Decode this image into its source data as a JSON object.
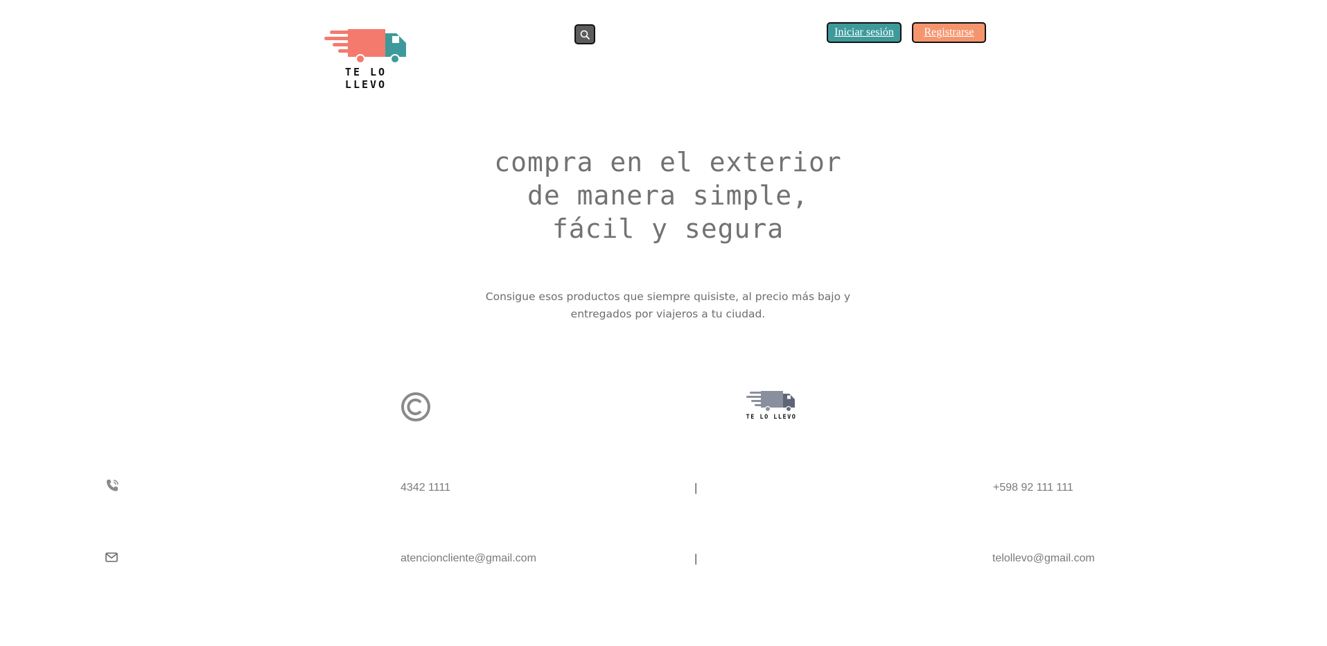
{
  "header": {
    "logo_text": "TE LO LLEVO",
    "login_label": "Iniciar sesión",
    "register_label": "Registrarse"
  },
  "hero": {
    "title": "compra en el exterior de manera simple, fácil y segura",
    "subtitle": "Consigue esos productos que siempre quisiste, al precio más bajo y entregados por viajeros a tu ciudad."
  },
  "footer": {
    "logo_text": "TE LO LLEVO",
    "phone_left": "4342 1111",
    "phone_right": "+598 92 111 111",
    "email_left": "atencioncliente@gmail.com",
    "email_right": "telollevo@gmail.com",
    "separator": "|"
  },
  "colors": {
    "accent_teal": "#3e9a9a",
    "accent_salmon": "#f5956e",
    "truck_red": "#f47a6e"
  }
}
